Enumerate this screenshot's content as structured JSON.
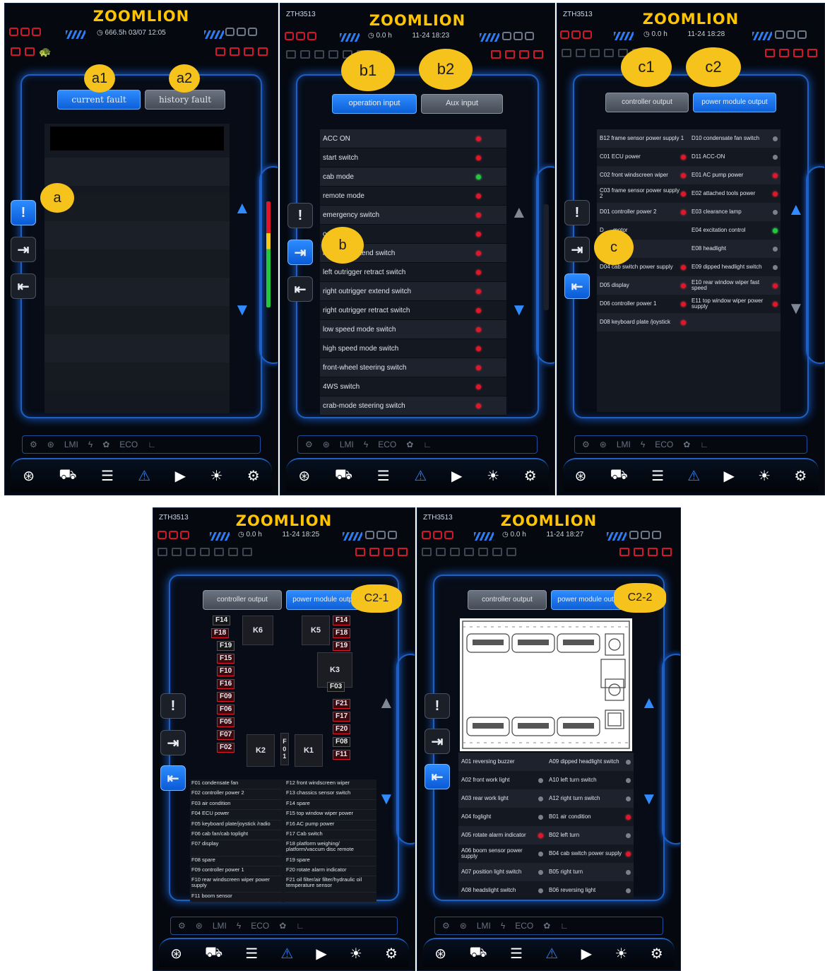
{
  "common": {
    "logo": "ZOOMLION",
    "model": "ZTH3513",
    "sidebar_icons": [
      "alert-icon",
      "input-icon",
      "output-icon"
    ],
    "nav_icons": [
      "steering-wheel-icon",
      "vehicle-icon",
      "adjust-icon",
      "warning-icon",
      "play-icon",
      "light-icon",
      "gear-icon"
    ],
    "bottom_strip": [
      "LMI",
      "ECO"
    ],
    "colors": {
      "accent": "#2d7cf0",
      "logo": "#ffc400",
      "alarm": "#e0172a",
      "ok": "#22c93d",
      "callout": "#f6c21c"
    }
  },
  "screen_a": {
    "hours": "666.5h",
    "date": "03/07",
    "time": "12:05",
    "tabs": {
      "current": "current fault",
      "history": "history fault"
    },
    "callouts": {
      "a": "a",
      "a1": "a1",
      "a2": "a2"
    }
  },
  "screen_b": {
    "hours": "0.0 h",
    "datetime": "11-24 18:23",
    "tabs": {
      "operation": "operation input",
      "aux": "Aux input"
    },
    "callouts": {
      "b": "b",
      "b1": "b1",
      "b2": "b2"
    },
    "rows": [
      {
        "label": "ACC ON",
        "state": "red"
      },
      {
        "label": "start switch",
        "state": "red"
      },
      {
        "label": "cab mode",
        "state": "green"
      },
      {
        "label": "remote mode",
        "state": "red"
      },
      {
        "label": "emergency switch",
        "state": "red"
      },
      {
        "label": "o        witch",
        "state": "red"
      },
      {
        "label": "le      ger extend switch",
        "state": "red"
      },
      {
        "label": "left outrigger retract switch",
        "state": "red"
      },
      {
        "label": "right outrigger extend switch",
        "state": "red"
      },
      {
        "label": "right outrigger retract switch",
        "state": "red"
      },
      {
        "label": "low speed mode switch",
        "state": "red"
      },
      {
        "label": "high speed mode switch",
        "state": "red"
      },
      {
        "label": "front-wheel steering switch",
        "state": "red"
      },
      {
        "label": "4WS switch",
        "state": "red"
      },
      {
        "label": "crab-mode steering switch",
        "state": "red"
      }
    ]
  },
  "screen_c": {
    "hours": "0.0 h",
    "datetime": "11-24 18:28",
    "tabs": {
      "controller": "controller output",
      "power": "power module output"
    },
    "callouts": {
      "c": "c",
      "c1": "c1",
      "c2": "c2"
    },
    "cells": [
      {
        "label": "B12 frame sensor power supply 1",
        "state": ""
      },
      {
        "label": "D10 condensate fan switch",
        "state": "gray"
      },
      {
        "label": "C01 ECU power",
        "state": "red"
      },
      {
        "label": "D11 ACC-ON",
        "state": "gray"
      },
      {
        "label": "C02 front windscreen wiper",
        "state": "red"
      },
      {
        "label": "E01 AC pump power",
        "state": "red"
      },
      {
        "label": "C03 frame sensor power supply 2",
        "state": "red"
      },
      {
        "label": "E02 attached tools power",
        "state": "red"
      },
      {
        "label": "D01 controller power 2",
        "state": "red"
      },
      {
        "label": "E03 clearance lamp",
        "state": "gray"
      },
      {
        "label": "D      motor",
        "state": ""
      },
      {
        "label": "E04 excitation control",
        "state": "green"
      },
      {
        "label": "D      light",
        "state": ""
      },
      {
        "label": "E08 headlight",
        "state": "gray"
      },
      {
        "label": "D04 cab switch power supply",
        "state": "red"
      },
      {
        "label": "E09 dipped headlight switch",
        "state": "gray"
      },
      {
        "label": "D05 display",
        "state": "red"
      },
      {
        "label": "E10 rear window wiper fast speed",
        "state": "red"
      },
      {
        "label": "D06 controller power 1",
        "state": "red"
      },
      {
        "label": "E11 top window wiper power supply",
        "state": "red"
      },
      {
        "label": "D08 keyboard plate /joystick",
        "state": "red"
      },
      {
        "label": "",
        "state": ""
      }
    ]
  },
  "screen_c21": {
    "hours": "0.0 h",
    "datetime": "11-24 18:25",
    "tabs": {
      "controller": "controller output",
      "power": "power module output"
    },
    "callout": "C2-1",
    "relays": [
      "K6",
      "K5",
      "K3",
      "K2",
      "K1"
    ],
    "f01_vertical": "F\n0\n1",
    "fuses_left": [
      {
        "label": "F14",
        "red": false
      },
      {
        "label": "F18",
        "red": true
      },
      {
        "label": "F19",
        "red": false
      },
      {
        "label": "F15",
        "red": true
      },
      {
        "label": "F10",
        "red": true
      },
      {
        "label": "F16",
        "red": true
      },
      {
        "label": "F09",
        "red": true
      },
      {
        "label": "F06",
        "red": true
      },
      {
        "label": "F05",
        "red": true
      },
      {
        "label": "F07",
        "red": true
      },
      {
        "label": "F02",
        "red": true
      }
    ],
    "fuses_right": [
      {
        "label": "F14",
        "red": true
      },
      {
        "label": "F18",
        "red": true
      },
      {
        "label": "F19",
        "red": true
      },
      {
        "label": "F03",
        "red": false
      },
      {
        "label": "F21",
        "red": true
      },
      {
        "label": "F17",
        "red": true
      },
      {
        "label": "F20",
        "red": true
      },
      {
        "label": "F08",
        "red": false
      },
      {
        "label": "F11",
        "red": true
      }
    ],
    "legend": [
      "F01 condensate fan",
      "F12 front windscreen wiper",
      "F02 controller power 2",
      "F13 chassics sensor switch",
      "F03 air condition",
      "F14 spare",
      "F04 ECU power",
      "F15 top window wiper power",
      "F05 keyboard plate/joystick /radio",
      "F16 AC pump power",
      "F06 cab fan/cab toplight",
      "F17 Cab switch",
      "F07 display",
      "F18 platform weighing/ platform/vaccum disc remote",
      "F08 spare",
      "F19 spare",
      "F09 controller power 1",
      "F20 rotate alarm indicator",
      "F10 rear windscreen wiper power supply",
      "F21 oil filter/air filter/hydraulic oil temperature sensor",
      "F11 boom sensor",
      ""
    ]
  },
  "screen_c22": {
    "hours": "0.0 h",
    "datetime": "11-24 18:27",
    "tabs": {
      "controller": "controller output",
      "power": "power module output"
    },
    "callout": "C2-2",
    "cells": [
      {
        "label": "A01 reversing buzzer",
        "state": ""
      },
      {
        "label": "A09 dipped headlight switch",
        "state": "gray"
      },
      {
        "label": "A02 front work light",
        "state": "gray"
      },
      {
        "label": "A10 left turn switch",
        "state": "gray"
      },
      {
        "label": "A03 rear work light",
        "state": "gray"
      },
      {
        "label": "A12 right turn switch",
        "state": "gray"
      },
      {
        "label": "A04 foglight",
        "state": "gray"
      },
      {
        "label": "B01 air condition",
        "state": "red"
      },
      {
        "label": "A05 rotate alarm indicator",
        "state": "red"
      },
      {
        "label": "B02 left turn",
        "state": "gray"
      },
      {
        "label": "A06 boom sensor power supply",
        "state": "gray"
      },
      {
        "label": "B04 cab switch power supply",
        "state": "red"
      },
      {
        "label": "A07 position light switch",
        "state": "gray"
      },
      {
        "label": "B05 right turn",
        "state": "gray"
      },
      {
        "label": "A08 headslight switch",
        "state": "gray"
      },
      {
        "label": "B06 reversing light",
        "state": "gray"
      }
    ]
  }
}
